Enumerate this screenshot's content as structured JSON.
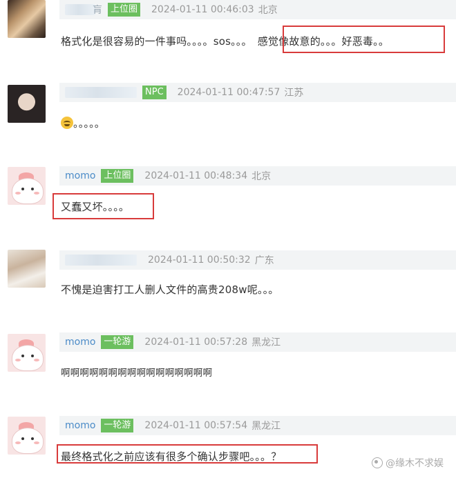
{
  "comments": [
    {
      "name": "",
      "name_partial": "肓",
      "tag": "上位圈",
      "time": "2024-01-11 00:46:03",
      "location": "北京",
      "text_a": "格式化是很容易的一件事吗。。。。sos。。。",
      "text_b": "感觉像故意的。。。好恶毒。。"
    },
    {
      "name": "",
      "tag": "NPC",
      "time": "2024-01-11 00:47:57",
      "location": "江苏",
      "text": "。。。。。",
      "emoji": "grinning-face-emoji"
    },
    {
      "name": "momo",
      "tag": "上位圈",
      "time": "2024-01-11 00:48:34",
      "location": "北京",
      "text": "又蠢又坏。。。。"
    },
    {
      "name": "",
      "tag": "",
      "time": "2024-01-11 00:50:32",
      "location": "广东",
      "text": "不愧是迫害打工人删人文件的高贵208w呢。。。"
    },
    {
      "name": "momo",
      "tag": "一轮游",
      "time": "2024-01-11 00:57:28",
      "location": "黑龙江",
      "text": "啊啊啊啊啊啊啊啊啊啊啊啊啊啊啊啊"
    },
    {
      "name": "momo",
      "tag": "一轮游",
      "time": "2024-01-11 00:57:54",
      "location": "黑龙江",
      "text": "最终格式化之前应该有很多个确认步骤吧。。。？"
    }
  ],
  "watermark": "@缘木不求娱",
  "colors": {
    "highlight": "#d83a3a",
    "tag_green": "#6cbf5f",
    "username": "#4b8bc8"
  }
}
